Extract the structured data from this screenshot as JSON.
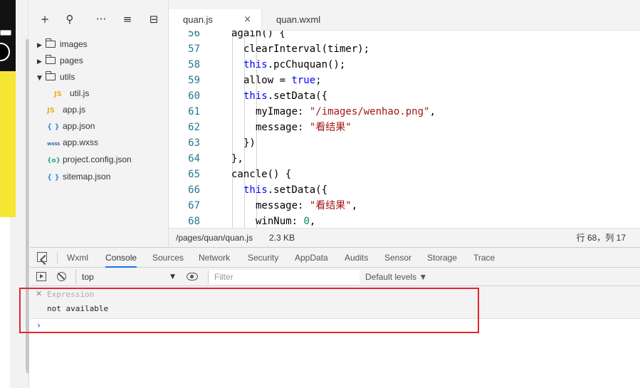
{
  "tree": {
    "items": [
      {
        "label": "images",
        "type": "folder",
        "expanded": false
      },
      {
        "label": "pages",
        "type": "folder",
        "expanded": false
      },
      {
        "label": "utils",
        "type": "folder",
        "expanded": true
      },
      {
        "label": "util.js",
        "type": "js",
        "badge": "JS"
      },
      {
        "label": "app.js",
        "type": "js",
        "badge": "JS"
      },
      {
        "label": "app.json",
        "type": "json",
        "badge": "{ }"
      },
      {
        "label": "app.wxss",
        "type": "wxss",
        "badge": "wxss"
      },
      {
        "label": "project.config.json",
        "type": "cfg",
        "badge": "{o}"
      },
      {
        "label": "sitemap.json",
        "type": "json",
        "badge": "{ }"
      }
    ]
  },
  "editor": {
    "tabs": [
      {
        "label": "quan.js",
        "active": true,
        "close": "×"
      },
      {
        "label": "quan.wxml",
        "active": false
      }
    ],
    "lines": [
      {
        "n": "56",
        "indent": 1,
        "tokens": [
          {
            "t": "again() {",
            "c": ""
          }
        ]
      },
      {
        "n": "57",
        "indent": 2,
        "tokens": [
          {
            "t": "clearInterval(timer);",
            "c": ""
          }
        ]
      },
      {
        "n": "58",
        "indent": 2,
        "tokens": [
          {
            "t": "this",
            "c": "kw"
          },
          {
            "t": ".pcChuquan();",
            "c": ""
          }
        ]
      },
      {
        "n": "59",
        "indent": 2,
        "tokens": [
          {
            "t": "allow = ",
            "c": ""
          },
          {
            "t": "true",
            "c": "kw"
          },
          {
            "t": ";",
            "c": ""
          }
        ]
      },
      {
        "n": "60",
        "indent": 2,
        "tokens": [
          {
            "t": "this",
            "c": "kw"
          },
          {
            "t": ".setData({",
            "c": ""
          }
        ]
      },
      {
        "n": "61",
        "indent": 3,
        "tokens": [
          {
            "t": "myImage: ",
            "c": ""
          },
          {
            "t": "\"/images/wenhao.png\"",
            "c": "str"
          },
          {
            "t": ",",
            "c": ""
          }
        ]
      },
      {
        "n": "62",
        "indent": 3,
        "tokens": [
          {
            "t": "message: ",
            "c": ""
          },
          {
            "t": "\"看结果\"",
            "c": "str"
          }
        ]
      },
      {
        "n": "63",
        "indent": 2,
        "tokens": [
          {
            "t": "})",
            "c": ""
          }
        ]
      },
      {
        "n": "64",
        "indent": 1,
        "tokens": [
          {
            "t": "},",
            "c": ""
          }
        ]
      },
      {
        "n": "65",
        "indent": 1,
        "tokens": [
          {
            "t": "cancle() {",
            "c": ""
          }
        ]
      },
      {
        "n": "66",
        "indent": 2,
        "tokens": [
          {
            "t": "this",
            "c": "kw"
          },
          {
            "t": ".setData({",
            "c": ""
          }
        ]
      },
      {
        "n": "67",
        "indent": 3,
        "tokens": [
          {
            "t": "message: ",
            "c": ""
          },
          {
            "t": "\"看结果\"",
            "c": "str"
          },
          {
            "t": ",",
            "c": ""
          }
        ]
      },
      {
        "n": "68",
        "indent": 3,
        "tokens": [
          {
            "t": "winNum: ",
            "c": ""
          },
          {
            "t": "0",
            "c": "num"
          },
          {
            "t": ",",
            "c": ""
          }
        ]
      }
    ]
  },
  "status": {
    "path": "/pages/quan/quan.js",
    "size": "2.3 KB",
    "cursor": "行 68，列 17"
  },
  "devtools": {
    "tabs": [
      "Wxml",
      "Console",
      "Sources",
      "Network",
      "Security",
      "AppData",
      "Audits",
      "Sensor",
      "Storage",
      "Trace"
    ],
    "active_tab": "Console",
    "context": "top",
    "filter_placeholder": "Filter",
    "levels": "Default levels ▼",
    "expression_label": "Expression",
    "expression_value": "not available",
    "prompt": "›"
  },
  "icons": {
    "new_file": "+",
    "search": "⚲",
    "more": "···",
    "collapse": "≡",
    "split": "⊟",
    "caret": "▼",
    "close_expr": "✕"
  },
  "colors": {
    "keyword": "#0000ff",
    "string": "#a31515",
    "number": "#098658",
    "line_number": "#237893",
    "highlight_box": "#e3262b",
    "phone_yellow": "#f7e533"
  }
}
